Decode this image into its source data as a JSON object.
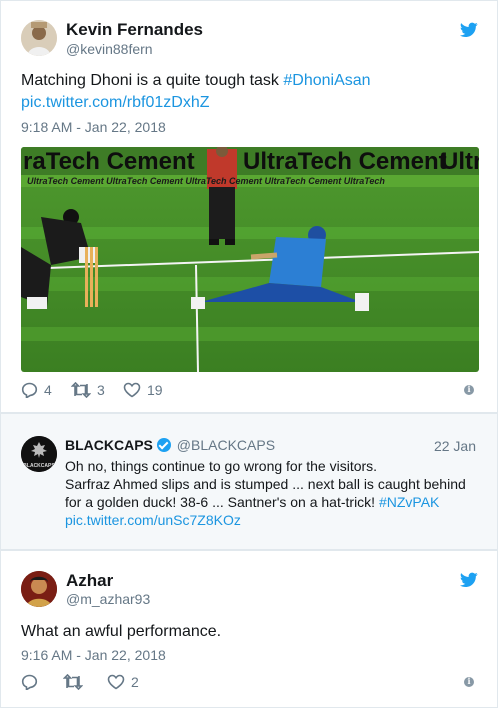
{
  "tweet1": {
    "name": "Kevin Fernandes",
    "handle": "@kevin88fern",
    "text_plain": "Matching Dhoni is a quite tough task ",
    "hashtag": "#DhoniAsan",
    "link": "pic.twitter.com/rbf01zDxhZ",
    "time": "9:18 AM - Jan 22, 2018",
    "photo_banner_left": "raTech Cement",
    "photo_banner_mid": "UltraTech Cement",
    "photo_banner_right": "Ultr",
    "photo_small_banner": "UltraTech Cement  UltraTech Cement  UltraTech Cement  UltraTech Cement  UltraTech",
    "replies": "4",
    "retweets": "3",
    "likes": "19"
  },
  "tweet2": {
    "name": "BLACKCAPS",
    "handle": "@BLACKCAPS",
    "date": "22 Jan",
    "avatar_text": "BLACKCAPS",
    "line1": "Oh no, things continue to go wrong for the visitors.",
    "line2": "Sarfraz Ahmed slips and is stumped ... next ball is caught behind",
    "line3_plain": "for a golden duck! 38-6 ... Santner's on a hat-trick! ",
    "line3_hashtag": "#NZvPAK",
    "link": "pic.twitter.com/unSc7Z8KOz"
  },
  "tweet3": {
    "name": "Azhar",
    "handle": "@m_azhar93",
    "text": "What an awful performance.",
    "time": "9:16 AM - Jan 22, 2018",
    "likes": "2"
  },
  "colors": {
    "link": "#1b95e0",
    "muted": "#657786",
    "twitter_blue": "#1da1f2"
  }
}
